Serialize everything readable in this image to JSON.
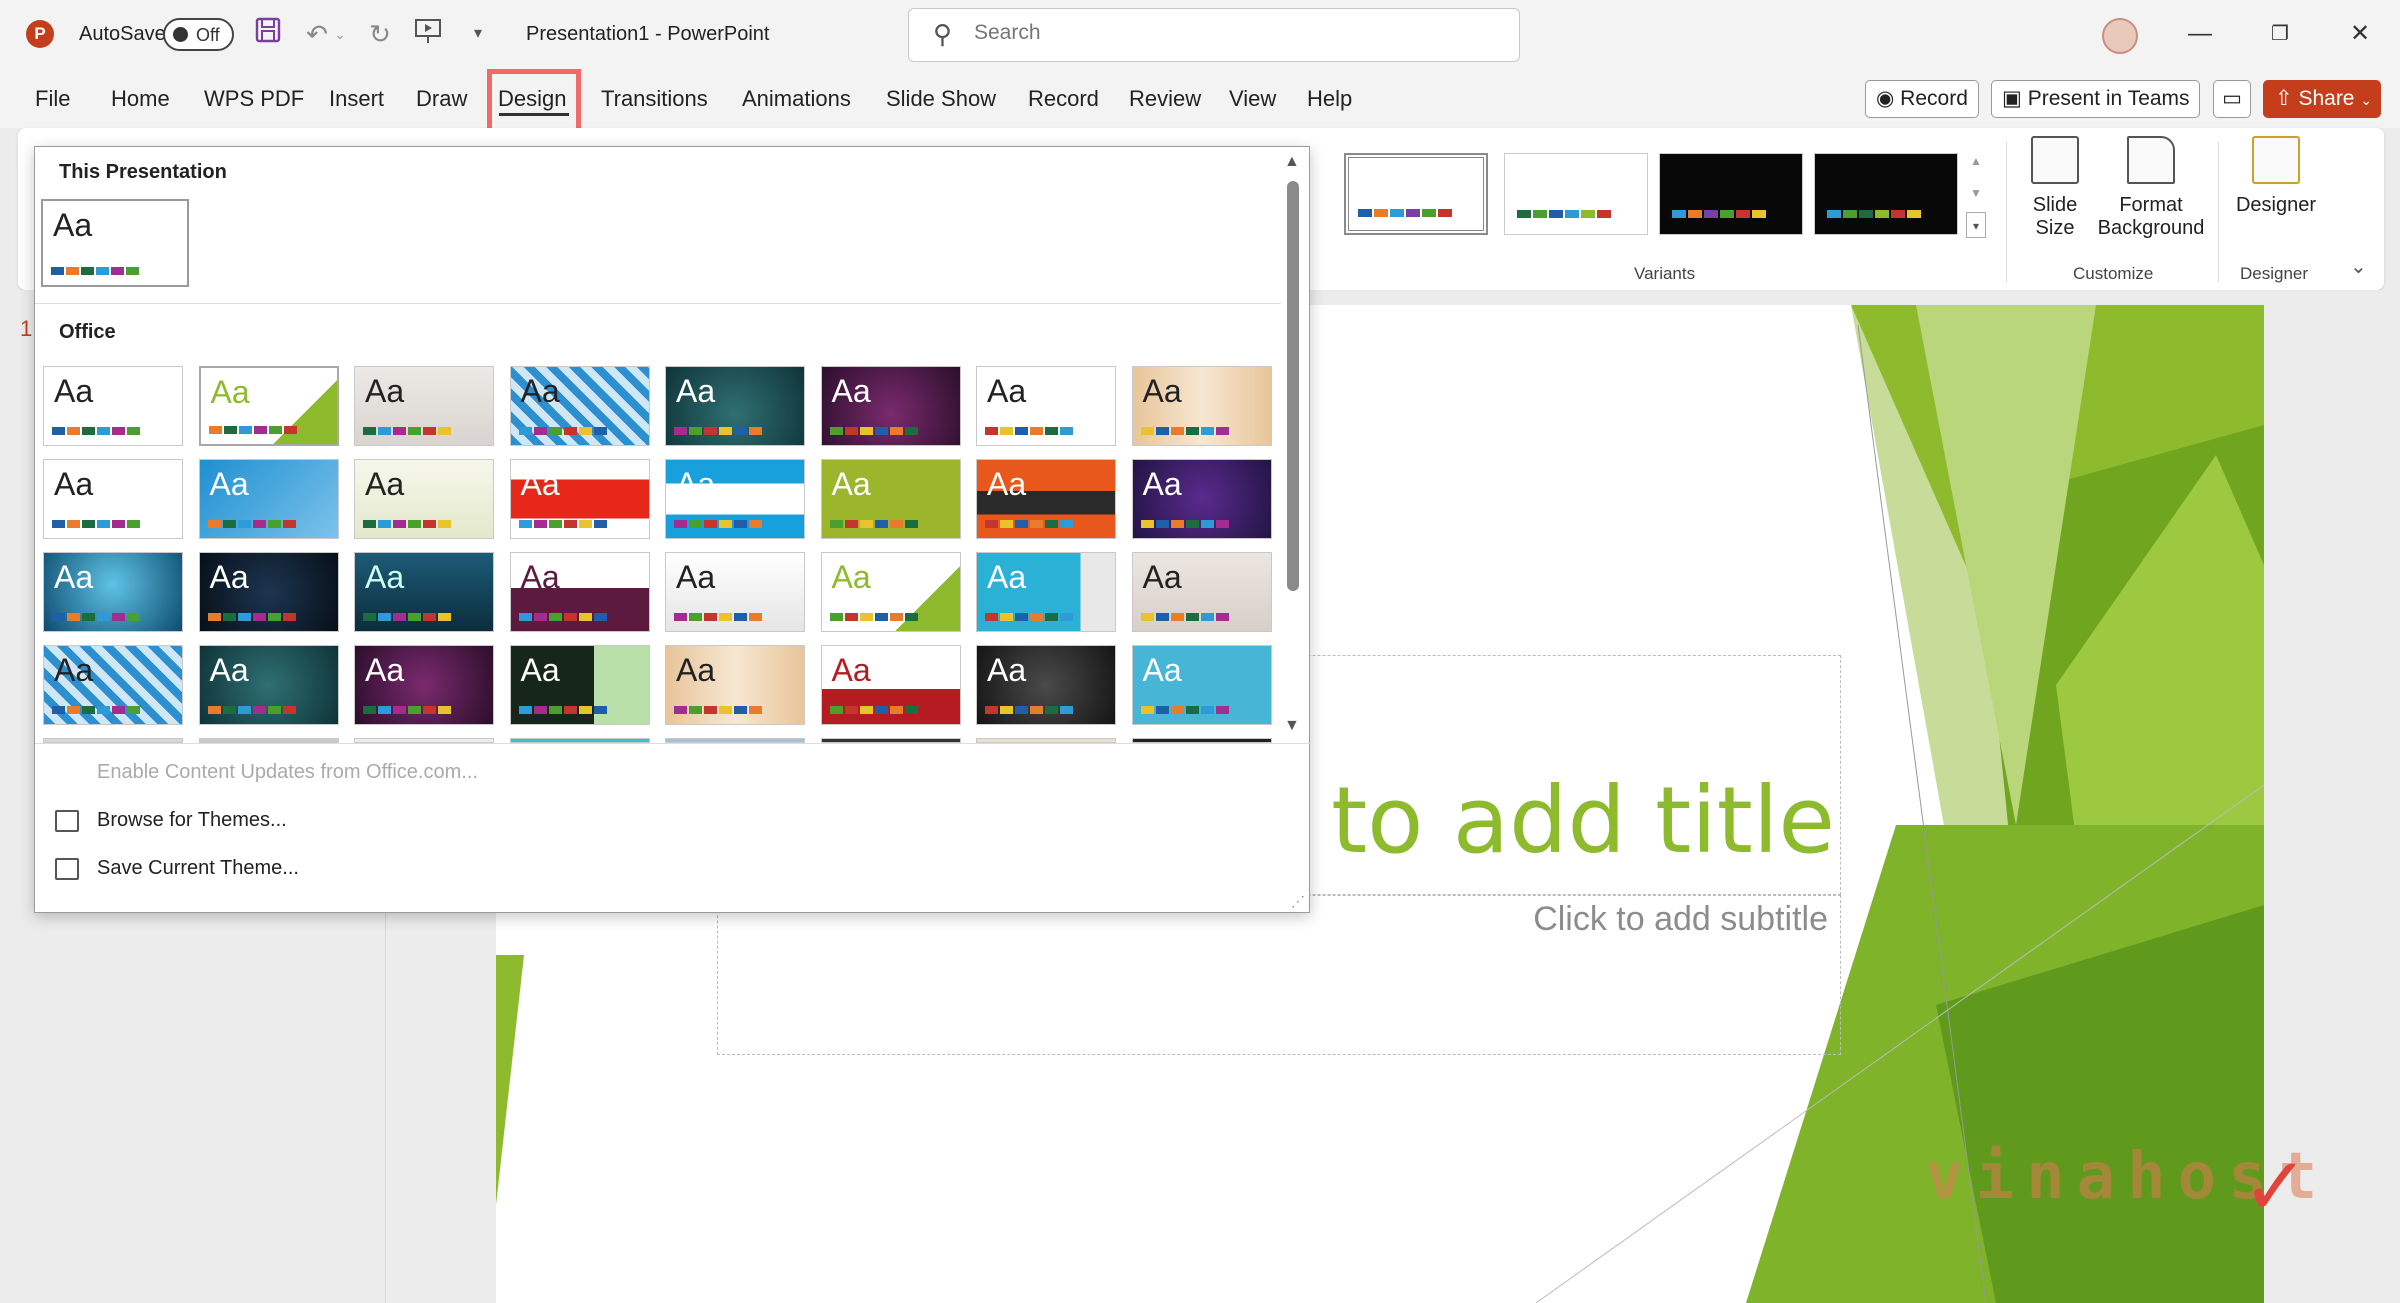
{
  "titlebar": {
    "app_logo": "P",
    "autosave_label": "AutoSave",
    "autosave_state": "Off",
    "doc_title": "Presentation1  -  PowerPoint",
    "search_placeholder": "Search"
  },
  "tabs": [
    {
      "label": "File"
    },
    {
      "label": "Home"
    },
    {
      "label": "WPS PDF"
    },
    {
      "label": "Insert"
    },
    {
      "label": "Draw"
    },
    {
      "label": "Design"
    },
    {
      "label": "Transitions"
    },
    {
      "label": "Animations"
    },
    {
      "label": "Slide Show"
    },
    {
      "label": "Record"
    },
    {
      "label": "Review"
    },
    {
      "label": "View"
    },
    {
      "label": "Help"
    }
  ],
  "active_tab": "Design",
  "actions": {
    "record_label": "Record",
    "teams_label": "Present in Teams",
    "share_label": "Share"
  },
  "ribbon": {
    "variants_label": "Variants",
    "customize_label": "Customize",
    "designer_group_label": "Designer",
    "slide_size_label": "Slide\nSize",
    "format_bg_label": "Format\nBackground",
    "designer_label": "Designer"
  },
  "gallery": {
    "this_presentation": "This Presentation",
    "office": "Office",
    "enable_updates": "Enable Content Updates from Office.com...",
    "browse_themes": "Browse for Themes...",
    "save_theme": "Save Current Theme...",
    "aa": "Aa"
  },
  "slide": {
    "number": "1",
    "title_text": "to add title",
    "subtitle_text": "Click to add subtitle"
  },
  "watermark": "vinahost",
  "colors": {
    "accent": "#c43e1c",
    "title_green": "#8dbb2d",
    "highlight_box": "#f06a6a"
  }
}
